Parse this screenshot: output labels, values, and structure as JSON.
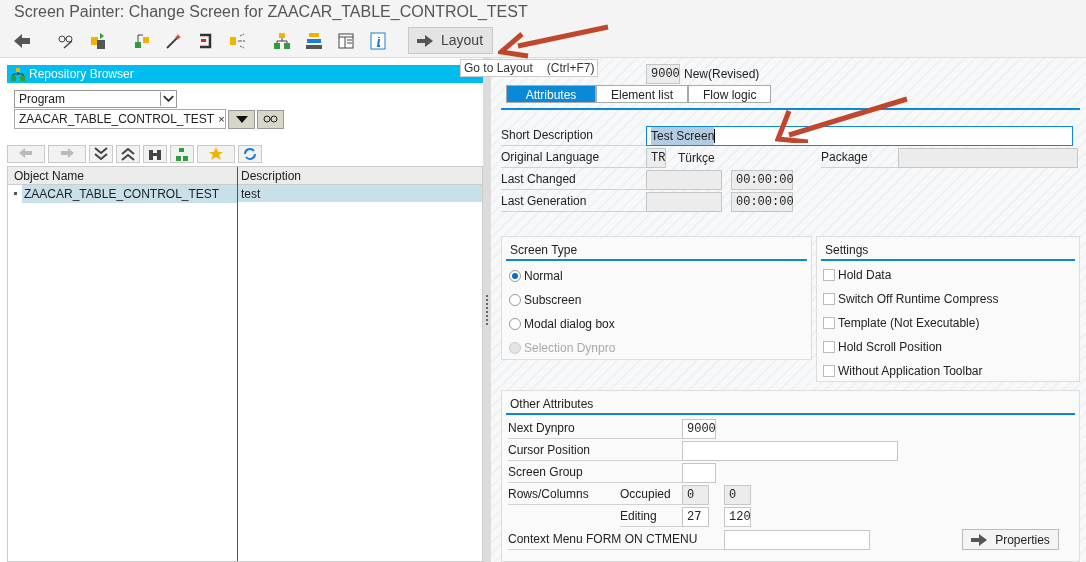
{
  "window": {
    "title": "Screen Painter: Change Screen for ZAACAR_TABLE_CONTROL_TEST"
  },
  "toolbar": {
    "button": "Layout"
  },
  "tooltip": {
    "text": "Go to Layout",
    "shortcut": "(Ctrl+F7)"
  },
  "repository_browser": {
    "title": "Repository Browser",
    "object_type": "Program",
    "object_name": "ZAACAR_TABLE_CONTROL_TEST",
    "clear": "×",
    "columns": [
      "Object Name",
      "Description"
    ],
    "rows": [
      {
        "name": "ZAACAR_TABLE_CONTROL_TEST",
        "description": "test",
        "selected": true
      }
    ]
  },
  "screen": {
    "number": "9000",
    "status": "New(Revised)"
  },
  "tabs": [
    {
      "label": "Attributes",
      "selected": true
    },
    {
      "label": "Element list",
      "selected": false
    },
    {
      "label": "Flow logic",
      "selected": false
    }
  ],
  "attributes": {
    "short_description_label": "Short Description",
    "short_description": "Test Screen",
    "language_label": "Original Language",
    "language_code": "TR",
    "language": "Türkçe",
    "package_label": "Package",
    "last_changed_label": "Last Changed",
    "last_changed_time": "00:00:00",
    "last_generation_label": "Last Generation",
    "last_generation_time": "00:00:00"
  },
  "screen_type": {
    "title": "Screen Type",
    "options": [
      {
        "label": "Normal",
        "selected": true,
        "disabled": false
      },
      {
        "label": "Subscreen",
        "selected": false,
        "disabled": false
      },
      {
        "label": "Modal dialog box",
        "selected": false,
        "disabled": false
      },
      {
        "label": "Selection Dynpro",
        "selected": false,
        "disabled": true
      }
    ]
  },
  "settings": {
    "title": "Settings",
    "options": [
      {
        "label": "Hold Data",
        "checked": false
      },
      {
        "label": "Switch Off Runtime Compress",
        "checked": false
      },
      {
        "label": "Template (Not Executable)",
        "checked": false
      },
      {
        "label": "Hold Scroll Position",
        "checked": false
      },
      {
        "label": "Without Application Toolbar",
        "checked": false
      }
    ]
  },
  "other_attributes": {
    "title": "Other Attributes",
    "next_dynpro_label": "Next Dynpro",
    "next_dynpro": "9000",
    "cursor_position_label": "Cursor Position",
    "screen_group_label": "Screen Group",
    "rows_columns_label": "Rows/Columns",
    "occupied_label": "Occupied",
    "occupied_rows": "0",
    "occupied_columns": "0",
    "editing_label": "Editing",
    "editing_rows": "27",
    "editing_columns": "120",
    "context_menu_label": "Context Menu FORM ON CTMENU",
    "properties_button": "Properties"
  }
}
